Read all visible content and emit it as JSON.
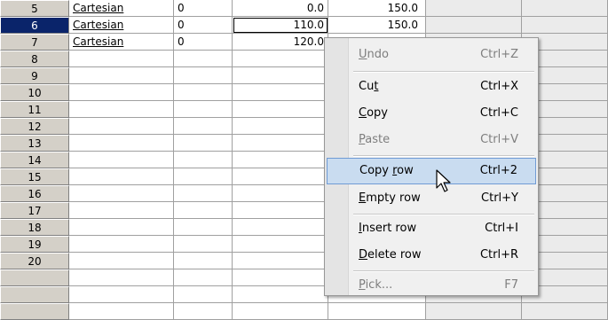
{
  "rows": [
    {
      "num": "5",
      "type": "Cartesian",
      "c2": "0",
      "c3": "0.0",
      "c4": "150.0"
    },
    {
      "num": "6",
      "type": "Cartesian",
      "c2": "0",
      "c3": "110.0",
      "c4": "150.0",
      "selected": true
    },
    {
      "num": "7",
      "type": "Cartesian",
      "c2": "0",
      "c3": "120.0",
      "c4": ""
    },
    {
      "num": "8"
    },
    {
      "num": "9"
    },
    {
      "num": "10"
    },
    {
      "num": "11"
    },
    {
      "num": "12"
    },
    {
      "num": "13"
    },
    {
      "num": "14"
    },
    {
      "num": "15"
    },
    {
      "num": "16"
    },
    {
      "num": "17"
    },
    {
      "num": "18"
    },
    {
      "num": "19"
    },
    {
      "num": "20"
    }
  ],
  "context_menu": {
    "undo": {
      "label": "Undo",
      "shortcut": "Ctrl+Z",
      "accel": "U"
    },
    "cut": {
      "label": "Cut",
      "shortcut": "Ctrl+X",
      "accel": "t"
    },
    "copy": {
      "label": "Copy",
      "shortcut": "Ctrl+C",
      "accel": "C"
    },
    "paste": {
      "label": "Paste",
      "shortcut": "Ctrl+V",
      "accel": "P"
    },
    "copy_row": {
      "label": "Copy row",
      "shortcut": "Ctrl+2",
      "accel": "r"
    },
    "empty_row": {
      "label": "Empty row",
      "shortcut": "Ctrl+Y",
      "accel": "E"
    },
    "insert_row": {
      "label": "Insert row",
      "shortcut": "Ctrl+I",
      "accel": "I"
    },
    "delete_row": {
      "label": "Delete row",
      "shortcut": "Ctrl+R",
      "accel": "D"
    },
    "pick": {
      "label": "Pick...",
      "shortcut": "F7",
      "accel": "P"
    }
  }
}
